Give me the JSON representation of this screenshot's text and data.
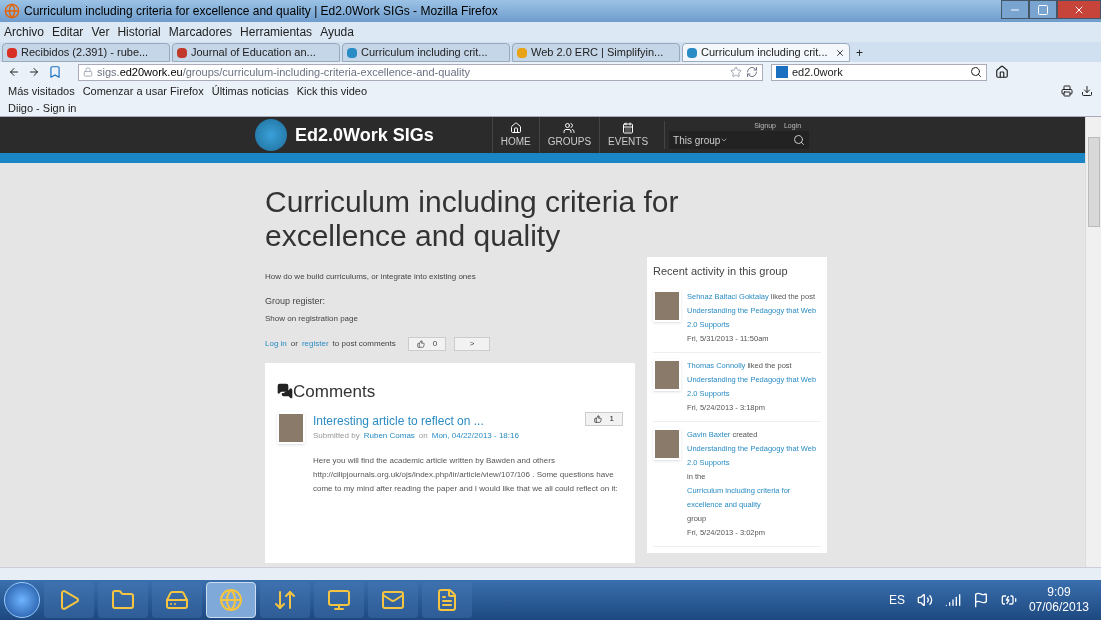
{
  "window": {
    "title": "Curriculum including criteria for excellence and quality | Ed2.0Work SIGs - Mozilla Firefox"
  },
  "menu": [
    "Archivo",
    "Editar",
    "Ver",
    "Historial",
    "Marcadores",
    "Herramientas",
    "Ayuda"
  ],
  "tabs": [
    {
      "label": "Recibidos (2.391) - rube...",
      "selected": false,
      "color": "#d93025"
    },
    {
      "label": "Journal of Education an...",
      "selected": false,
      "color": "#c0392b"
    },
    {
      "label": "Curriculum including crit...",
      "selected": false,
      "color": "#2a8cc4"
    },
    {
      "label": "Web 2.0 ERC | Simplifyin...",
      "selected": false,
      "color": "#e8a317"
    },
    {
      "label": "Curriculum including crit...",
      "selected": true,
      "color": "#2a8cc4"
    }
  ],
  "new_tab": "+",
  "address": {
    "host": "sigs.",
    "domain": "ed20work.eu",
    "path": "/groups/curriculum-including-criteria-excellence-and-quality"
  },
  "search": {
    "value": "ed2.0work"
  },
  "bookmarks": [
    "Más visitados",
    "Comenzar a usar Firefox",
    "Últimas noticias",
    "Kick this video"
  ],
  "bookmarks2": [
    "Diigo - Sign in"
  ],
  "site": {
    "name": "Ed2.0Work SIGs",
    "nav": [
      {
        "kind": "home",
        "label": "HOME"
      },
      {
        "kind": "groups",
        "label": "GROUPS"
      },
      {
        "kind": "events",
        "label": "EVENTS"
      }
    ],
    "scope": "This group",
    "account": [
      "Signup",
      "Login"
    ]
  },
  "group": {
    "title": "Curriculum including criteria for excellence and quality",
    "description": "How do we build curriculums, or integrate into existing ones",
    "register_label": "Group register:",
    "register_value": "Show on registration page",
    "login": "Log in",
    "or": "or",
    "register": "register",
    "post": "to post comments",
    "likes": "0",
    "share": ">"
  },
  "comments": {
    "heading": "Comments",
    "items": [
      {
        "title": "Interesting article to reflect on ...",
        "submitted": "Submitted by",
        "author": "Ruben Comas",
        "on": "on",
        "date": "Mon, 04/22/2013 - 18:16",
        "likes": "1",
        "body": "Here you will find the academic article written by Bawden and others http://cilipjournals.org.uk/ojs/index.php/lir/article/view/107/106 . Some questions have come to my mind after reading the paper and I would like that we all could reflect on it:"
      }
    ]
  },
  "activity": {
    "heading": "Recent activity in this group",
    "items": [
      {
        "parts": [
          {
            "text": "Sehnaz Baltaci Goktalay",
            "link": true
          },
          {
            "text": " liked the post ",
            "link": false
          },
          {
            "text": "Understanding the Pedagogy that Web 2.0 Supports",
            "link": true
          }
        ],
        "date": "Fri, 5/31/2013 - 11:50am"
      },
      {
        "parts": [
          {
            "text": "Thomas Connolly",
            "link": true
          },
          {
            "text": " liked the post ",
            "link": false
          },
          {
            "text": "Understanding the Pedagogy that Web 2.0 Supports",
            "link": true
          }
        ],
        "date": "Fri, 5/24/2013 - 3:18pm"
      },
      {
        "parts": [
          {
            "text": "Gavin Baxter",
            "link": true
          },
          {
            "text": " created ",
            "link": false
          },
          {
            "text": "Understanding the Pedagogy that Web 2.0 Supports",
            "link": true
          },
          {
            "text": " in the ",
            "link": false
          },
          {
            "text": "Curriculum including criteria for excellence and quality",
            "link": true
          },
          {
            "text": " group",
            "link": false
          }
        ],
        "date": "Fri, 5/24/2013 - 3:02pm"
      }
    ]
  },
  "taskbar": {
    "apps": [
      {
        "kind": "media",
        "active": false
      },
      {
        "kind": "folder",
        "active": false
      },
      {
        "kind": "drive",
        "active": false
      },
      {
        "kind": "browser",
        "active": true
      },
      {
        "kind": "download",
        "active": false
      },
      {
        "kind": "monitor",
        "active": false
      },
      {
        "kind": "mail",
        "active": false
      },
      {
        "kind": "word",
        "active": false
      }
    ],
    "language": "ES",
    "time": "9:09",
    "date": "07/06/2013"
  }
}
